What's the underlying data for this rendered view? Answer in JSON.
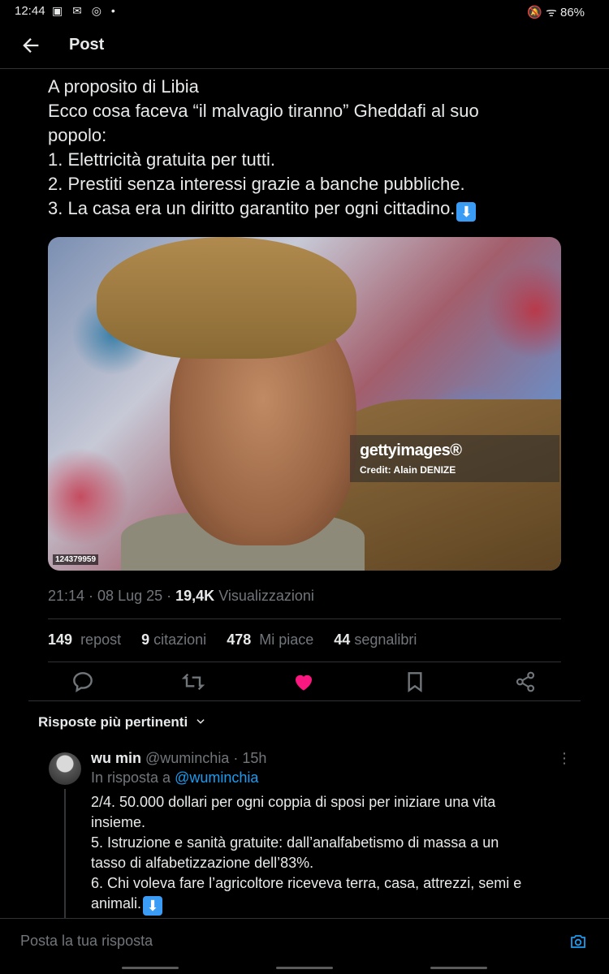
{
  "status_bar": {
    "time": "12:44",
    "left_icons": "▣ ✉ ◎ •",
    "right_text": "🔕 ᯤ 86%"
  },
  "header": {
    "title": "Post"
  },
  "tweet": {
    "lines": [
      "A proposito di Libia",
      "Ecco cosa faceva “il malvagio tiranno” Gheddafi al suo",
      "popolo:",
      "1. Elettricità gratuita per tutti.",
      "2. Prestiti senza interessi grazie a banche pubbliche.",
      "3. La casa era un diritto garantito per ogni cittadino."
    ],
    "arrow_emoji": "⬇",
    "image": {
      "getty_logo": "gettyimages®",
      "credit": "Credit: Alain DENIZE",
      "id": "124379959"
    },
    "meta": {
      "time": "21:14",
      "date": "08 Lug 25",
      "views_count": "19,4K",
      "views_label": "Visualizzazioni"
    },
    "stats": [
      {
        "n": "149",
        "label": "repost"
      },
      {
        "n": "9",
        "label": "citazioni"
      },
      {
        "n": "478",
        "label": "Mi piace"
      },
      {
        "n": "44",
        "label": "segnalibri"
      }
    ]
  },
  "replies": {
    "sort_label": "Risposte più pertinenti",
    "first": {
      "name": "wu min",
      "handle": "@wuminchia",
      "age": "15h",
      "reply_to_label": "In risposta a",
      "reply_to_handle": "@wuminchia",
      "lines": [
        "2/4. 50.000 dollari per ogni coppia di sposi per iniziare una vita",
        "insieme.",
        "5. Istruzione e sanità gratuite: dall’analfabetismo di massa a un",
        "tasso di alfabetizzazione dell’83%.",
        "6. Chi voleva fare l’agricoltore riceveva terra, casa, attrezzi, semi e",
        "animali."
      ]
    }
  },
  "compose": {
    "placeholder": "Posta la tua risposta"
  },
  "colors": {
    "accent": "#1d9bf0",
    "like": "#f91880",
    "muted": "#71767b",
    "text": "#e7e9ea",
    "bg": "#000000"
  }
}
